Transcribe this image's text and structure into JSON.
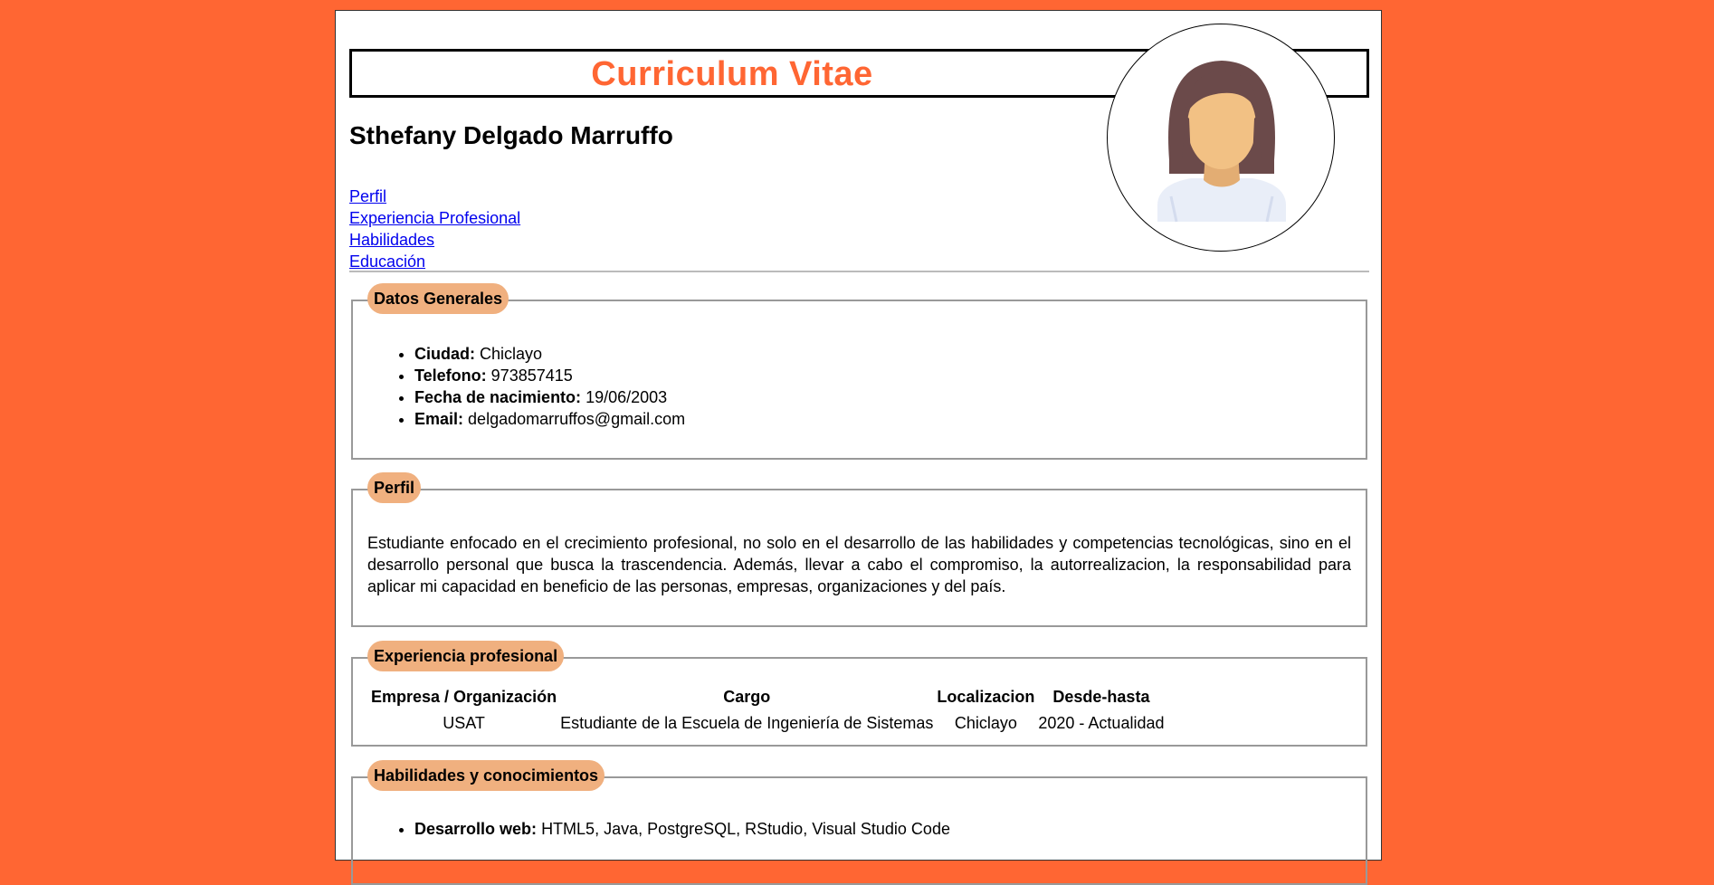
{
  "header": {
    "title": "Curriculum Vitae",
    "name": "Sthefany Delgado Marruffo"
  },
  "nav": {
    "links": [
      "Perfil",
      "Experiencia Profesional",
      "Habilidades",
      "Educación"
    ]
  },
  "datos_generales": {
    "legend": "Datos Generales",
    "items": [
      {
        "label": "Ciudad:",
        "value": "Chiclayo"
      },
      {
        "label": "Telefono:",
        "value": "973857415"
      },
      {
        "label": "Fecha de nacimiento:",
        "value": "19/06/2003"
      },
      {
        "label": "Email:",
        "value": "delgadomarruffos@gmail.com"
      }
    ]
  },
  "perfil": {
    "legend": "Perfil",
    "text": "Estudiante enfocado en el crecimiento profesional, no solo en el desarrollo de las habilidades y competencias tecnológicas, sino en el desarrollo personal que busca la trascendencia. Además, llevar a cabo el compromiso, la autorrealizacion, la responsabilidad para aplicar mi capacidad en beneficio de las personas, empresas, organizaciones y del país."
  },
  "experiencia": {
    "legend": "Experiencia profesional",
    "headers": [
      "Empresa / Organización",
      "Cargo",
      "Localizacion",
      "Desde-hasta"
    ],
    "rows": [
      [
        "USAT",
        "Estudiante de la Escuela de Ingeniería de Sistemas",
        "Chiclayo",
        "2020 - Actualidad"
      ]
    ]
  },
  "habilidades": {
    "legend": "Habilidades y conocimientos",
    "items": [
      {
        "label": "Desarrollo web:",
        "value": "HTML5, Java, PostgreSQL, RStudio, Visual Studio Code"
      }
    ]
  },
  "colors": {
    "background": "#ff6633",
    "title": "#ff6633",
    "legend_bg": "#f0b07f",
    "link": "#0000ee"
  },
  "icons": {
    "avatar": "female-user-avatar-icon"
  }
}
